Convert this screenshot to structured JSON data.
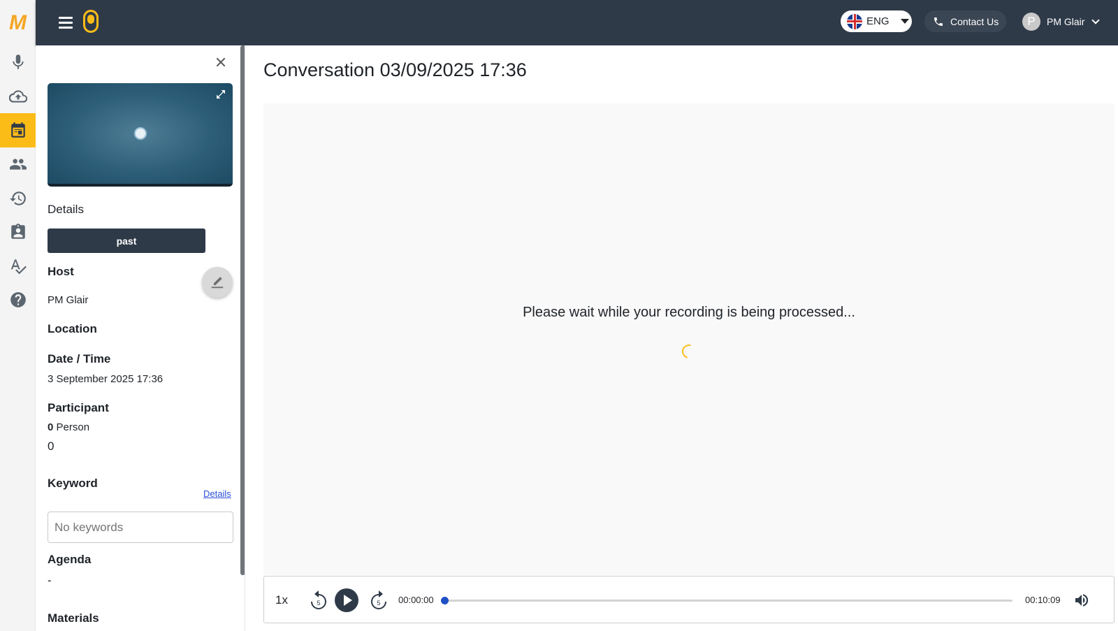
{
  "brand": {
    "logo_letter": "M",
    "accent": "#fbbc18",
    "dark": "#2f3a48"
  },
  "rail": {
    "items": [
      {
        "name": "microphone",
        "icon": "mic-icon",
        "active": false
      },
      {
        "name": "upload",
        "icon": "cloud-upload-icon",
        "active": false
      },
      {
        "name": "calendar",
        "icon": "calendar-icon",
        "active": true
      },
      {
        "name": "people",
        "icon": "people-icon",
        "active": false
      },
      {
        "name": "history",
        "icon": "history-icon",
        "active": false
      },
      {
        "name": "contacts",
        "icon": "contact-card-icon",
        "active": false
      },
      {
        "name": "spellcheck",
        "icon": "spellcheck-icon",
        "active": false
      },
      {
        "name": "help",
        "icon": "help-icon",
        "active": false
      }
    ]
  },
  "topbar": {
    "language": "ENG",
    "contact_label": "Contact Us",
    "user_initial": "P",
    "user_name": "PM Glair"
  },
  "panel": {
    "details_title": "Details",
    "status": "past",
    "host_label": "Host",
    "host_value": "PM Glair",
    "location_label": "Location",
    "datetime_label": "Date / Time",
    "datetime_value": "3 September 2025 17:36",
    "participant_label": "Participant",
    "participant_count": "0",
    "participant_unit": "Person",
    "participant_value": "0",
    "keyword_label": "Keyword",
    "keyword_details_link": "Details",
    "keyword_placeholder": "No keywords",
    "agenda_label": "Agenda",
    "agenda_value": "-",
    "materials_label": "Materials"
  },
  "main": {
    "title": "Conversation 03/09/2025 17:36",
    "processing_message": "Please wait while your recording is being processed..."
  },
  "player": {
    "speed": "1x",
    "rewind_seconds": "5",
    "forward_seconds": "5",
    "current_time": "00:00:00",
    "duration": "00:10:09",
    "progress": 0
  }
}
